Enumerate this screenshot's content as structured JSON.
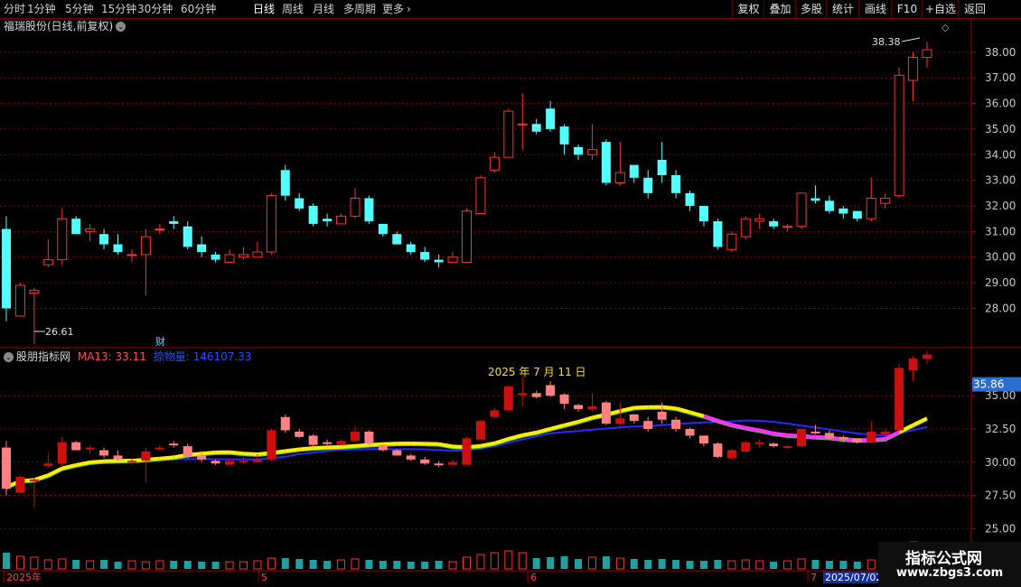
{
  "toolbar": {
    "left": [
      {
        "label": "分时",
        "active": false
      },
      {
        "label": "1分钟",
        "active": false
      },
      {
        "label": "5分钟",
        "active": false
      },
      {
        "label": "15分钟",
        "active": false
      },
      {
        "label": "30分钟",
        "active": false
      },
      {
        "label": "60分钟",
        "active": false
      },
      {
        "label": "日线",
        "active": true
      },
      {
        "label": "周线",
        "active": false
      },
      {
        "label": "月线",
        "active": false
      },
      {
        "label": "多周期",
        "active": false
      },
      {
        "label": "更多",
        "active": false
      }
    ],
    "right": [
      "复权",
      "叠加",
      "多股",
      "统计",
      "画线",
      "F10",
      "+自选",
      "返回"
    ]
  },
  "main_title": "福瑞股份(日线,前复权)",
  "sub_panel": {
    "name": "股朋指标网",
    "ma_label": "MA13: 33.11",
    "extra_label": "捺物量: 146107.33",
    "date_text": "2025 年 7 月 11 日",
    "current_tag": "35.86"
  },
  "markers": {
    "high_label": "38.38",
    "low_label": "26.61",
    "cai_label": "财"
  },
  "time_axis": [
    "2025年",
    "5",
    "6",
    "7",
    "2025/07/02"
  ],
  "watermark": {
    "line1": "指标公式网",
    "line2": "www.zbgs3.com"
  },
  "colors": {
    "up": "#ff3030",
    "down": "#54ffff",
    "grid": "#8b0000",
    "text": "#c8c8c8",
    "tag": "#2a6fd0"
  },
  "chart_data": {
    "type": "candlestick",
    "main_axis": {
      "ylim": [
        26.5,
        38.7
      ],
      "ticks": [
        28,
        29,
        30,
        31,
        32,
        33,
        34,
        35,
        36,
        37,
        38
      ]
    },
    "sub_axis": {
      "ylim": [
        24,
        37.6
      ],
      "ticks": [
        25.0,
        27.5,
        30.0,
        32.5,
        35.0
      ]
    },
    "candles": [
      [
        31.1,
        28.0,
        31.6,
        27.5
      ],
      [
        27.7,
        28.9,
        29.0,
        27.7
      ],
      [
        28.6,
        28.7,
        28.8,
        26.6
      ],
      [
        29.7,
        29.9,
        30.7,
        29.6
      ],
      [
        29.9,
        31.5,
        31.9,
        29.7
      ],
      [
        31.5,
        30.9,
        31.6,
        30.9
      ],
      [
        31.0,
        31.1,
        31.3,
        30.6
      ],
      [
        30.9,
        30.5,
        31.1,
        30.3
      ],
      [
        30.5,
        30.2,
        30.9,
        30.1
      ],
      [
        30.1,
        30.1,
        30.3,
        29.8
      ],
      [
        30.1,
        30.8,
        31.1,
        28.5
      ],
      [
        31.1,
        31.1,
        31.3,
        30.9
      ],
      [
        31.4,
        31.3,
        31.6,
        31.1
      ],
      [
        31.2,
        30.4,
        31.4,
        30.3
      ],
      [
        30.5,
        30.2,
        30.8,
        30.0
      ],
      [
        30.1,
        29.9,
        30.2,
        29.8
      ],
      [
        29.8,
        30.1,
        30.3,
        29.9
      ],
      [
        30.0,
        30.1,
        30.4,
        29.9
      ],
      [
        30.0,
        30.2,
        30.6,
        30.0
      ],
      [
        30.2,
        32.4,
        32.5,
        30.1
      ],
      [
        33.4,
        32.4,
        33.6,
        32.2
      ],
      [
        32.3,
        31.9,
        32.5,
        31.8
      ],
      [
        32.0,
        31.3,
        32.1,
        31.2
      ],
      [
        31.5,
        31.4,
        31.7,
        31.2
      ],
      [
        31.3,
        31.6,
        31.7,
        31.3
      ],
      [
        31.6,
        32.3,
        32.7,
        31.5
      ],
      [
        32.3,
        31.4,
        32.4,
        31.3
      ],
      [
        31.3,
        30.9,
        31.3,
        30.8
      ],
      [
        30.9,
        30.5,
        31.0,
        30.5
      ],
      [
        30.5,
        30.2,
        30.6,
        30.1
      ],
      [
        30.2,
        29.9,
        30.4,
        29.8
      ],
      [
        29.9,
        29.8,
        30.1,
        29.6
      ],
      [
        29.8,
        30.0,
        30.2,
        29.8
      ],
      [
        29.8,
        31.8,
        31.9,
        29.8
      ],
      [
        31.7,
        33.1,
        33.2,
        31.7
      ],
      [
        33.4,
        33.9,
        34.1,
        33.3
      ],
      [
        33.9,
        35.7,
        35.8,
        33.9
      ],
      [
        35.2,
        35.2,
        36.4,
        34.2
      ],
      [
        35.2,
        34.9,
        35.4,
        34.8
      ],
      [
        35.8,
        35.0,
        36.1,
        34.9
      ],
      [
        35.1,
        34.4,
        35.2,
        34.0
      ],
      [
        34.3,
        34.0,
        34.4,
        33.8
      ],
      [
        34.0,
        34.2,
        35.2,
        33.8
      ],
      [
        34.5,
        32.9,
        34.6,
        32.8
      ],
      [
        32.9,
        33.3,
        34.5,
        32.8
      ],
      [
        33.6,
        33.1,
        33.6,
        32.9
      ],
      [
        33.1,
        32.5,
        33.4,
        32.3
      ],
      [
        33.8,
        33.2,
        34.5,
        32.9
      ],
      [
        33.2,
        32.5,
        33.4,
        32.3
      ],
      [
        32.5,
        32.0,
        32.6,
        31.8
      ],
      [
        32.0,
        31.4,
        32.0,
        31.2
      ],
      [
        31.4,
        30.4,
        31.5,
        30.3
      ],
      [
        30.3,
        30.9,
        31.0,
        30.2
      ],
      [
        30.8,
        31.5,
        31.6,
        30.7
      ],
      [
        31.4,
        31.5,
        31.7,
        31.1
      ],
      [
        31.4,
        31.2,
        31.5,
        31.1
      ],
      [
        31.2,
        31.2,
        31.3,
        31.0
      ],
      [
        31.2,
        32.5,
        32.5,
        31.1
      ],
      [
        32.3,
        32.2,
        32.8,
        32.1
      ],
      [
        32.2,
        31.8,
        32.4,
        31.7
      ],
      [
        31.9,
        31.7,
        32.0,
        31.5
      ],
      [
        31.8,
        31.5,
        31.8,
        31.4
      ],
      [
        31.5,
        32.3,
        33.1,
        31.4
      ],
      [
        32.1,
        32.3,
        32.5,
        31.9
      ],
      [
        32.4,
        37.1,
        37.4,
        32.3
      ],
      [
        36.9,
        37.8,
        38.0,
        36.1
      ],
      [
        37.8,
        38.1,
        38.4,
        37.4
      ]
    ],
    "volumes": [
      18,
      14,
      13,
      10,
      11,
      10,
      9,
      10,
      8,
      9,
      8,
      9,
      9,
      9,
      8,
      8,
      8,
      8,
      9,
      12,
      12,
      11,
      10,
      9,
      10,
      11,
      10,
      9,
      9,
      8,
      8,
      9,
      8,
      13,
      16,
      18,
      20,
      18,
      12,
      13,
      14,
      11,
      13,
      14,
      12,
      11,
      10,
      11,
      10,
      9,
      9,
      10,
      9,
      10,
      9,
      8,
      9,
      11,
      10,
      9,
      9,
      8,
      10,
      10,
      24,
      30,
      26
    ]
  }
}
